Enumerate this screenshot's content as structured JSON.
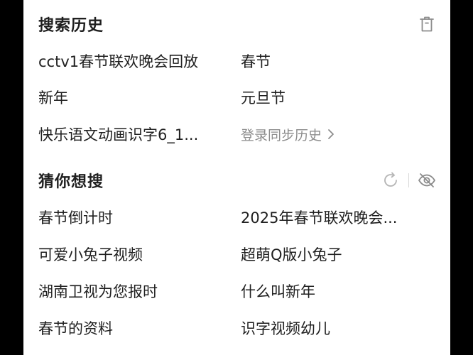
{
  "history": {
    "title": "搜索历史",
    "items": [
      {
        "label": "cctv1春节联欢晚会回放"
      },
      {
        "label": "春节"
      },
      {
        "label": "新年"
      },
      {
        "label": "元旦节"
      },
      {
        "label": "快乐语文动画识字6_1..."
      }
    ],
    "login_sync": "登录同步历史",
    "icons": {
      "delete": "trash-icon",
      "chevron": "chevron-right-icon"
    }
  },
  "suggest": {
    "title": "猜你想搜",
    "items": [
      {
        "label": "春节倒计时"
      },
      {
        "label": "2025年春节联欢晚会..."
      },
      {
        "label": "可爱小兔子视频"
      },
      {
        "label": "超萌Q版小兔子"
      },
      {
        "label": "湖南卫视为您报时"
      },
      {
        "label": "什么叫新年"
      },
      {
        "label": "春节的资料"
      },
      {
        "label": "识字视频幼儿"
      }
    ],
    "icons": {
      "refresh": "refresh-icon",
      "hide": "eye-off-icon"
    }
  },
  "colors": {
    "text_primary": "#1f1f1f",
    "text_secondary": "#8c8c8c",
    "icon": "#8c8c8c",
    "background": "#ffffff",
    "outer": "#000000"
  }
}
